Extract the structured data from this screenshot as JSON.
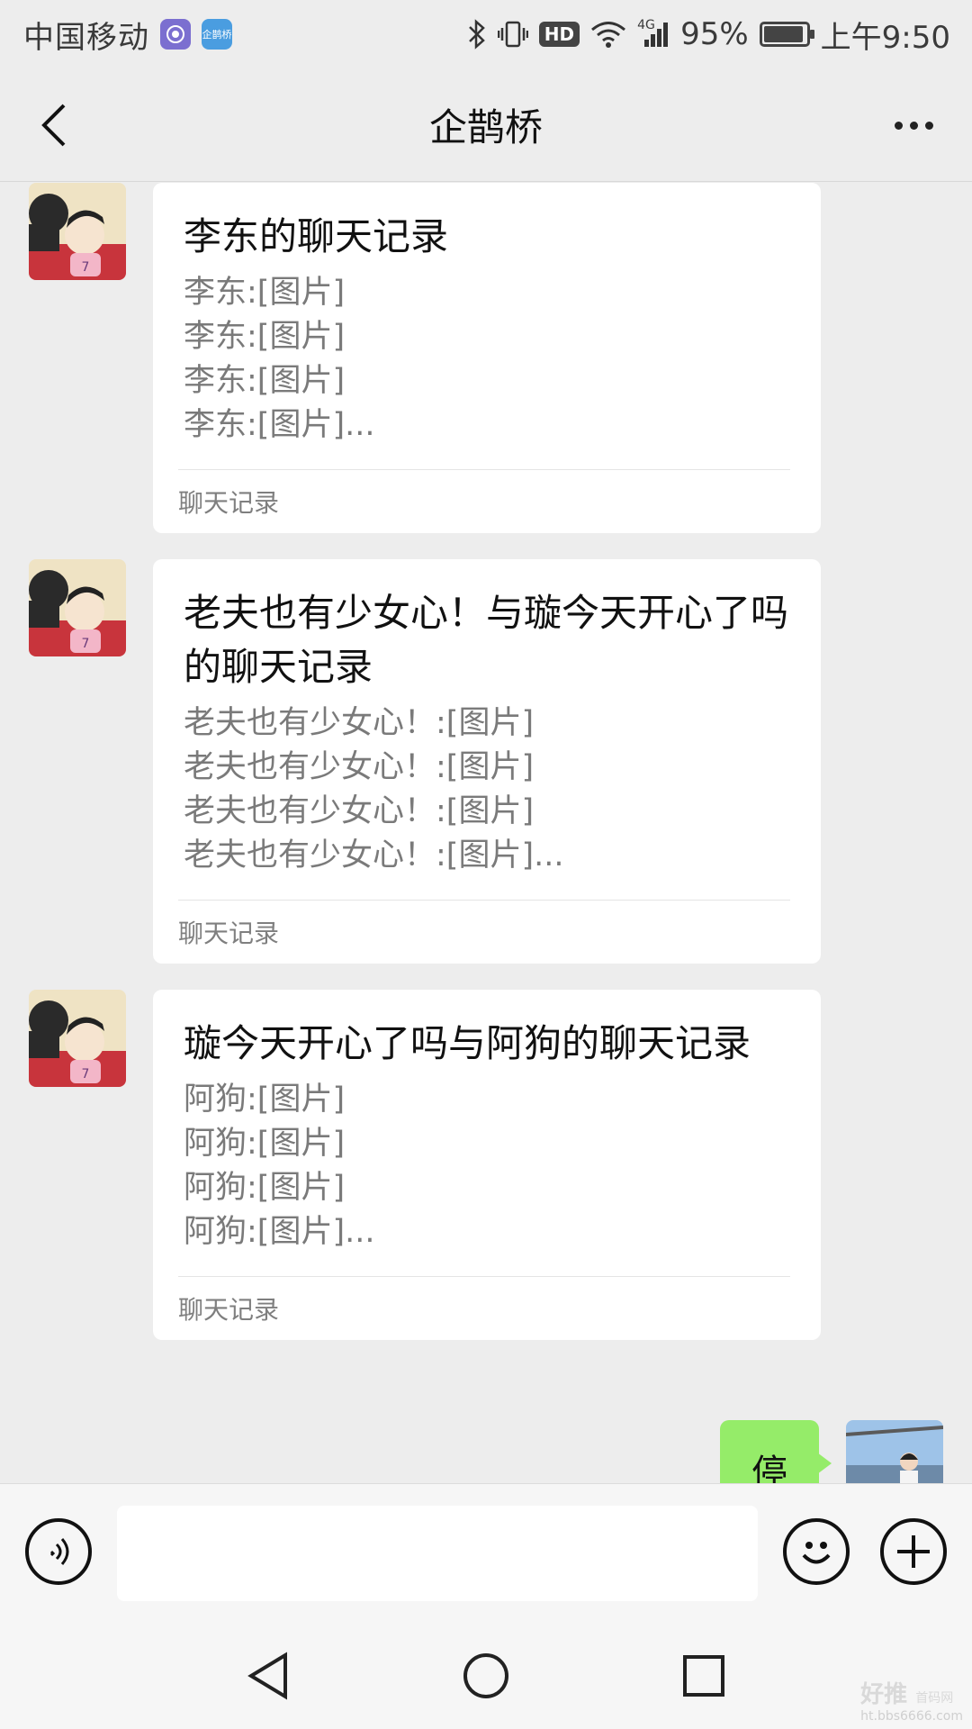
{
  "status_bar": {
    "carrier": "中国移动",
    "app_badge_text": "企鹊桥",
    "network": "4G",
    "hd": "HD",
    "battery_percent": "95%",
    "battery_level": 0.95,
    "time": "上午9:50"
  },
  "nav": {
    "title": "企鹊桥"
  },
  "messages": [
    {
      "title": "李东的聊天记录",
      "lines": [
        "李东:[图片]",
        "李东:[图片]",
        "李东:[图片]",
        "李东:[图片]..."
      ],
      "footer": "聊天记录"
    },
    {
      "title": "老夫也有少女心！与璇今天开心了吗的聊天记录",
      "lines": [
        "老夫也有少女心！:[图片]",
        "老夫也有少女心！:[图片]",
        "老夫也有少女心！:[图片]",
        "老夫也有少女心！:[图片]..."
      ],
      "footer": "聊天记录"
    },
    {
      "title": "璇今天开心了吗与阿狗的聊天记录",
      "lines": [
        "阿狗:[图片]",
        "阿狗:[图片]",
        "阿狗:[图片]",
        "阿狗:[图片]..."
      ],
      "footer": "聊天记录"
    }
  ],
  "my_message": {
    "text": "停"
  },
  "input": {
    "value": "",
    "placeholder": ""
  },
  "watermark": {
    "main": "好推",
    "sub": "首码网",
    "url": "ht.bbs6666.com"
  },
  "colors": {
    "background": "#ededed",
    "card": "#ffffff",
    "my_bubble": "#95ec69",
    "avatar_red": "#c8343c"
  }
}
